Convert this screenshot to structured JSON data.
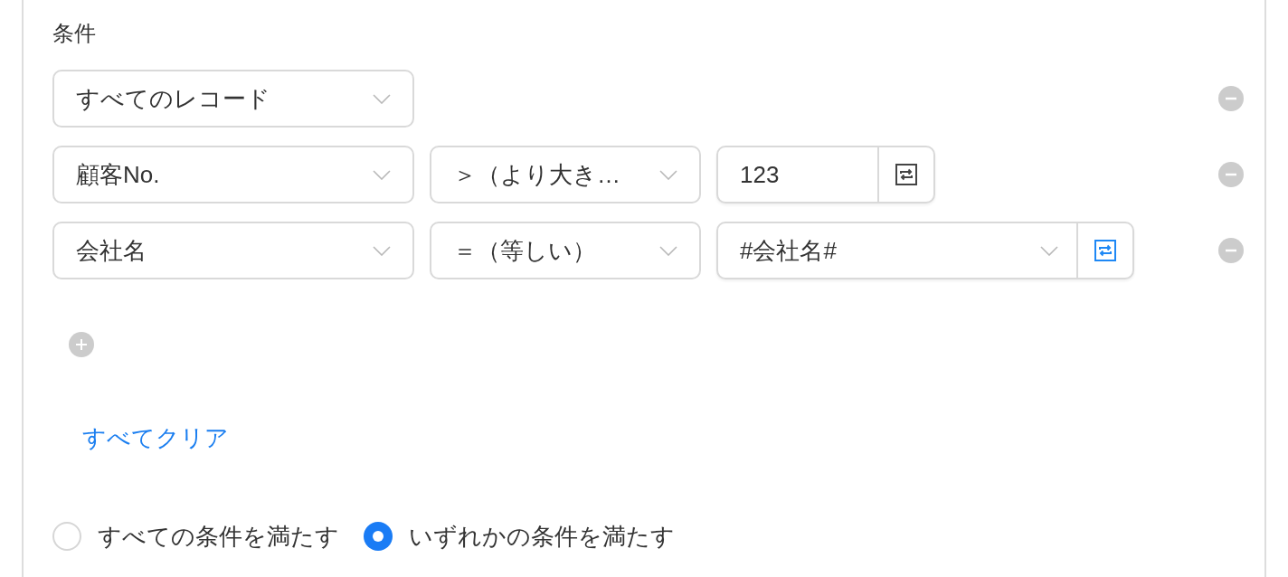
{
  "label": "条件",
  "conditions": [
    {
      "field": "すべてのレコード"
    },
    {
      "field": "顧客No.",
      "operator": "＞（より大き…",
      "value": {
        "kind": "text",
        "text": "123",
        "active": false
      }
    },
    {
      "field": "会社名",
      "operator": "＝（等しい）",
      "value": {
        "kind": "select",
        "text": "#会社名#",
        "active": true
      }
    }
  ],
  "clear_link": "すべてクリア",
  "match_options": [
    {
      "label": "すべての条件を満たす",
      "selected": false
    },
    {
      "label": "いずれかの条件を満たす",
      "selected": true
    }
  ]
}
